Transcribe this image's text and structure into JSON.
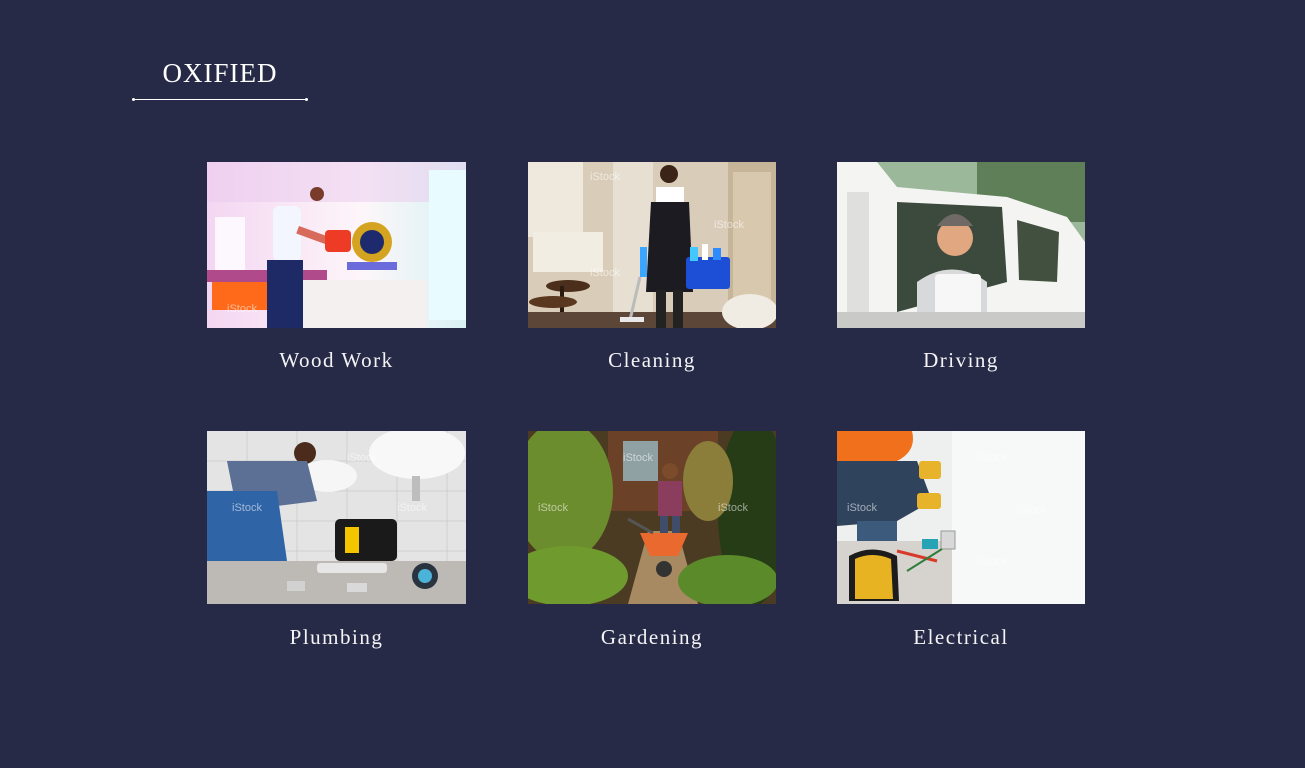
{
  "brand": {
    "title": "OXIFIED"
  },
  "services": [
    {
      "label": "Wood Work",
      "image": "woodwork-photo"
    },
    {
      "label": "Cleaning",
      "image": "cleaning-photo"
    },
    {
      "label": "Driving",
      "image": "driving-photo"
    },
    {
      "label": "Plumbing",
      "image": "plumbing-photo"
    },
    {
      "label": "Gardening",
      "image": "gardening-photo"
    },
    {
      "label": "Electrical",
      "image": "electrical-photo"
    }
  ],
  "colors": {
    "background": "#262a47",
    "text": "#ffffff"
  }
}
